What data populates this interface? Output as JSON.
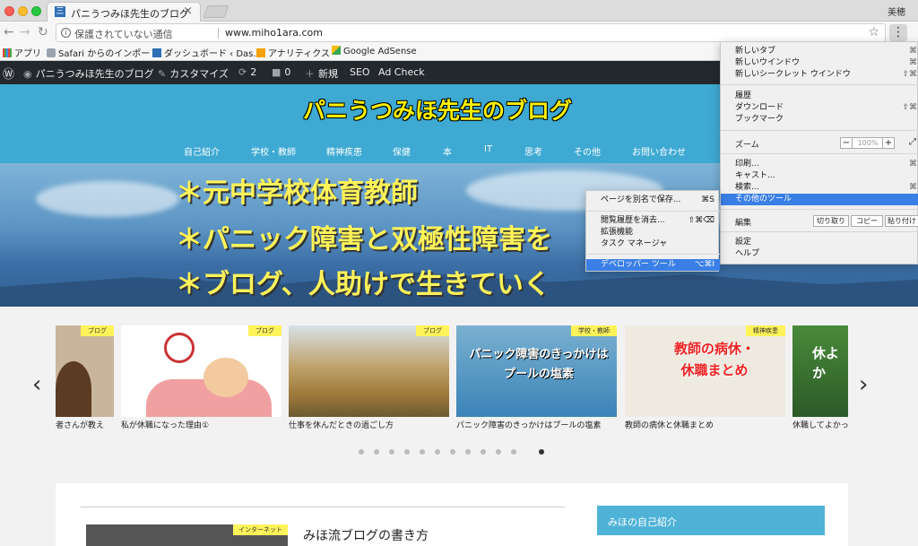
{
  "browser": {
    "tab_title": "パニうつみほ先生のブログ",
    "profile_name": "美穂",
    "security_text": "保護されていない通信",
    "url": "www.miho1ara.com"
  },
  "bookmarks": [
    "アプリ",
    "Safari からのインポート",
    "ダッシュボード ‹ Das…",
    "アナリティクス",
    "Google AdSense"
  ],
  "admin_bar": {
    "site": "パニうつみほ先生のブログ",
    "customize": "カスタマイズ",
    "updates": "2",
    "comments": "0",
    "new": "新規",
    "seo": "SEO",
    "adcheck": "Ad Check"
  },
  "site": {
    "title": "パニうつみほ先生のブログ",
    "nav": [
      "自己紹介",
      "学校・教師",
      "精神疾患",
      "保健",
      "本",
      "IT",
      "思考",
      "その他",
      "お問い合わせ"
    ]
  },
  "hero": {
    "lines": [
      "＊元中学校体育教師",
      "＊パニック障害と双極性障害を",
      "＊ブログ、人助けで生きていく"
    ]
  },
  "carousel": {
    "cards": [
      {
        "badge": "ブログ",
        "caption": "者さんが教え"
      },
      {
        "badge": "ブログ",
        "caption": "私が休職になった理由①"
      },
      {
        "badge": "ブログ",
        "caption": "仕事を休んだときの過ごし方"
      },
      {
        "badge": "学校・教師",
        "caption": "パニック障害のきっかけはプールの塩素",
        "img_text": "パニック障害のきっかけはプールの塩素"
      },
      {
        "badge": "精神疾患",
        "caption": "教師の病休と休職まとめ",
        "img_text": "教師の病休・休職まとめ"
      },
      {
        "badge": "",
        "caption": "休職してよかっ",
        "img_text": "休よか"
      }
    ],
    "dot_count": 12,
    "active_dot": 11
  },
  "bottom": {
    "post_badge": "インターネット",
    "post_title": "みほ流ブログの書き方",
    "profile_title": "みほの自己紹介"
  },
  "chrome_menu": {
    "items": [
      {
        "label": "新しいタブ",
        "shortcut": "⌘"
      },
      {
        "label": "新しいウインドウ",
        "shortcut": "⌘"
      },
      {
        "label": "新しいシークレット ウインドウ",
        "shortcut": "⇧⌘"
      },
      {
        "label": "履歴",
        "shortcut": ""
      },
      {
        "label": "ダウンロード",
        "shortcut": "⇧⌘"
      },
      {
        "label": "ブックマーク",
        "shortcut": ""
      },
      {
        "label": "印刷...",
        "shortcut": "⌘"
      },
      {
        "label": "キャスト...",
        "shortcut": ""
      },
      {
        "label": "検索...",
        "shortcut": "⌘"
      },
      {
        "label": "その他のツール",
        "shortcut": ""
      },
      {
        "label": "設定",
        "shortcut": ""
      },
      {
        "label": "ヘルプ",
        "shortcut": ""
      }
    ],
    "zoom_label": "ズーム",
    "zoom_value": "100%",
    "edit_label": "編集",
    "cut": "切り取り",
    "copy": "コピー",
    "paste": "貼り付け"
  },
  "submenu": {
    "items": [
      {
        "label": "ページを別名で保存...",
        "shortcut": "⌘S"
      },
      {
        "label": "閲覧履歴を消去...",
        "shortcut": "⇧⌘⌫"
      },
      {
        "label": "拡張機能",
        "shortcut": ""
      },
      {
        "label": "タスク マネージャ",
        "shortcut": ""
      },
      {
        "label": "デベロッパー ツール",
        "shortcut": "⌥⌘I"
      }
    ]
  }
}
